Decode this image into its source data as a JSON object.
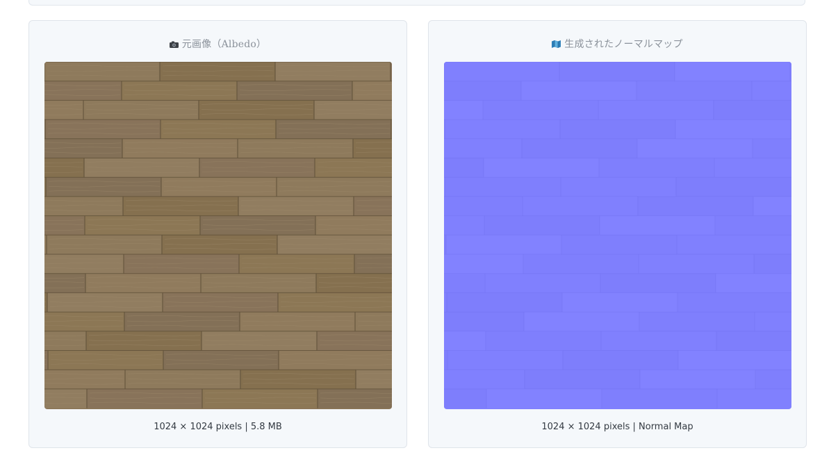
{
  "panels": {
    "albedo": {
      "title": "元画像（Albedo）",
      "icon": "camera-icon",
      "caption": "1024 × 1024 pixels | 5.8 MB"
    },
    "normal": {
      "title": "生成されたノーマルマップ",
      "icon": "map-icon",
      "caption": "1024 × 1024 pixels | Normal Map"
    }
  },
  "colors": {
    "wood_base": "#8b7658",
    "wood_seam": "#5f5039",
    "normal_base": "#8080fe",
    "normal_seam": "#7474f2",
    "panel_bg": "#f5f8fb",
    "panel_border": "#dfe4ea"
  }
}
